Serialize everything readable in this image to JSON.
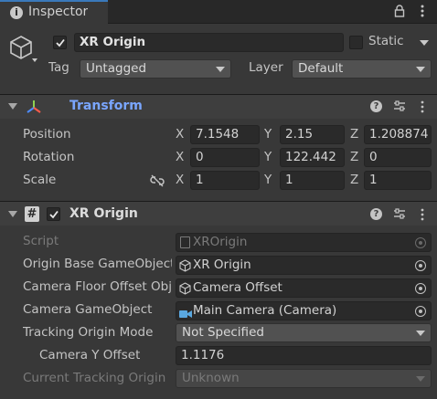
{
  "tab": {
    "title": "Inspector"
  },
  "header": {
    "name": "XR Origin",
    "static_label": "Static",
    "tag_label": "Tag",
    "tag_value": "Untagged",
    "layer_label": "Layer",
    "layer_value": "Default"
  },
  "transform": {
    "title": "Transform",
    "rows": [
      {
        "label": "Position",
        "x": "7.1548",
        "y": "2.15",
        "z": "1.208874"
      },
      {
        "label": "Rotation",
        "x": "0",
        "y": "122.442",
        "z": "0"
      },
      {
        "label": "Scale",
        "x": "1",
        "y": "1",
        "z": "1"
      }
    ],
    "axes": [
      "X",
      "Y",
      "Z"
    ]
  },
  "xr_origin": {
    "title": "XR Origin",
    "script_label": "Script",
    "script_value": "XROrigin",
    "origin_base_label": "Origin Base GameObject",
    "origin_base_value": "XR Origin",
    "camera_floor_label": "Camera Floor Offset Object",
    "camera_floor_value": "Camera Offset",
    "camera_go_label": "Camera GameObject",
    "camera_go_value": "Main Camera (Camera)",
    "tracking_mode_label": "Tracking Origin Mode",
    "tracking_mode_value": "Not Specified",
    "camera_y_label": "Camera Y Offset",
    "camera_y_value": "1.1176",
    "current_tracking_label": "Current Tracking Origin",
    "current_tracking_value": "Unknown"
  },
  "colors": {
    "background": "#383838",
    "tab_bar": "#282828",
    "component_header": "#3e3e3e",
    "transform_title": "#7aa6ff"
  }
}
